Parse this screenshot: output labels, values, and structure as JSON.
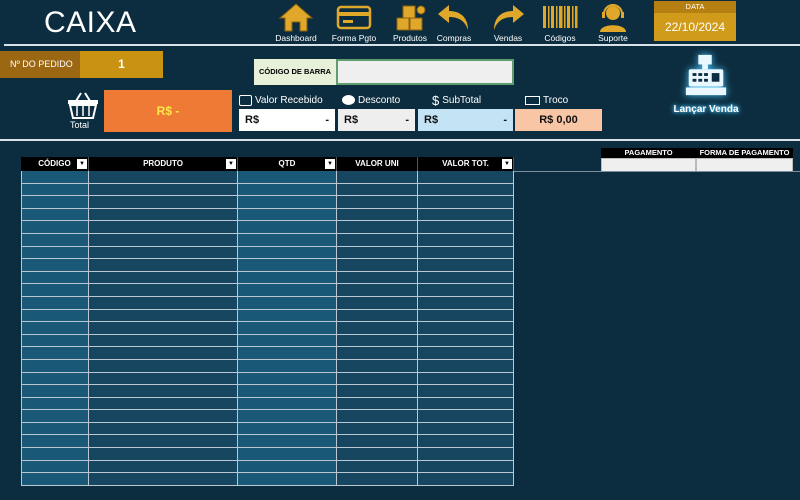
{
  "app": {
    "title": "CAIXA"
  },
  "nav": [
    {
      "label": "Dashboard",
      "icon": "home-icon"
    },
    {
      "label": "Forma Pgto",
      "icon": "credit-card-icon"
    },
    {
      "label": "Produtos",
      "icon": "boxes-icon"
    },
    {
      "label": "Compras",
      "icon": "undo-arrow-icon"
    },
    {
      "label": "Vendas",
      "icon": "redo-arrow-icon"
    },
    {
      "label": "Códigos",
      "icon": "barcode-icon"
    },
    {
      "label": "Suporte",
      "icon": "headset-icon"
    }
  ],
  "date": {
    "label": "DATA",
    "value": "22/10/2024"
  },
  "pedido": {
    "label": "Nº DO PEDIDO",
    "value": "1"
  },
  "barcode": {
    "label": "CÓDIGO DE BARRA",
    "value": ""
  },
  "total": {
    "label": "Total",
    "value": "R$ -"
  },
  "fields": {
    "recebido": {
      "label": "Valor Recebido",
      "currency": "R$",
      "value": "-"
    },
    "desconto": {
      "label": "Desconto",
      "currency": "R$",
      "value": "-"
    },
    "subtotal": {
      "label": "SubTotal",
      "currency": "R$",
      "value": "-"
    },
    "troco": {
      "label": "Troco",
      "value": "R$ 0,00"
    }
  },
  "lancar": {
    "label": "Lançar Venda"
  },
  "table": {
    "columns": [
      "CÓDIGO",
      "PRODUTO",
      "QTD",
      "VALOR UNI",
      "VALOR TOT."
    ]
  },
  "payment": {
    "columns": [
      "PAGAMENTO",
      "FORMA DE PAGAMENTO"
    ]
  },
  "colors": {
    "accent": "#d09b1a",
    "total": "#ee7a35",
    "background": "#0c2d3f"
  }
}
